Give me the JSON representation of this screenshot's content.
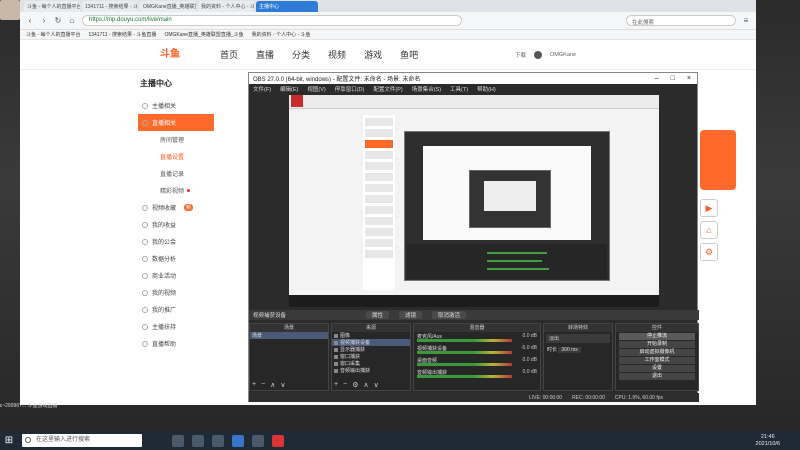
{
  "browser": {
    "tabs": [
      {
        "label": "斗鱼 - 每个人的直播平台"
      },
      {
        "label": "1341711 - 搜索结果 - 斗鱼直播"
      },
      {
        "label": "OMGKane直播_英雄联盟直播_斗鱼"
      },
      {
        "label": "我的资料 - 个人中心 - 斗鱼"
      },
      {
        "label": "主播中心"
      }
    ],
    "url": "https://mp.douyu.com/live/main",
    "search_placeholder": "在此搜索",
    "bookmarks": [
      "斗鱼 - 每个人的直播平台",
      "1341711 - 搜索结果 - 斗鱼直播",
      "OMGKane直播_英雄联盟直播_斗鱼",
      "我的资料 - 个人中心 - 斗鱼"
    ]
  },
  "site": {
    "logo_text": "斗鱼",
    "nav": [
      "首页",
      "直播",
      "分类",
      "视频",
      "游戏",
      "鱼吧"
    ],
    "download": "下载",
    "username": "OMGKane"
  },
  "sidebar": {
    "title": "主播中心",
    "items": [
      {
        "label": "主播相关"
      },
      {
        "label": "直播相关"
      },
      {
        "label": "房间管理"
      },
      {
        "label": "直播设置"
      },
      {
        "label": "直播记录"
      },
      {
        "label": "精彩视频"
      },
      {
        "label": "视频收藏"
      },
      {
        "label": "我的收益"
      },
      {
        "label": "我的公会"
      },
      {
        "label": "数据分析"
      },
      {
        "label": "商业活动"
      },
      {
        "label": "我的视频"
      },
      {
        "label": "我的推广"
      },
      {
        "label": "主播扶持"
      },
      {
        "label": "直播帮助"
      }
    ],
    "badge": "新"
  },
  "obs": {
    "title": "OBS 27.0.0 (64-bit, windows) - 配置文件: 未命名 - 场景: 未命名",
    "menu": [
      "文件(F)",
      "编辑(E)",
      "视图(V)",
      "停靠窗口(D)",
      "配置文件(P)",
      "场景集合(S)",
      "工具(T)",
      "帮助(H)"
    ],
    "source_bar": {
      "label": "视频捕获设备",
      "props": "属性",
      "filters": "滤镜",
      "deactivate": "取消激活"
    },
    "docks": {
      "scenes": {
        "title": "场景",
        "items": [
          "场景"
        ]
      },
      "sources": {
        "title": "来源",
        "items": [
          "图像",
          "视频捕获设备",
          "显示器捕获",
          "窗口捕获",
          "窗口采集",
          "音频输出捕获"
        ]
      },
      "mixer": {
        "title": "混音器",
        "rows": [
          {
            "name": "麦克风/Aux",
            "vol": "0.0 dB"
          },
          {
            "name": "视频捕获设备",
            "vol": "-5.0 dB"
          },
          {
            "name": "桌面音频",
            "vol": "0.0 dB"
          },
          {
            "name": "音频输出捕获",
            "vol": "0.0 dB"
          }
        ]
      },
      "transitions": {
        "title": "转场特效",
        "type": "淡出",
        "duration_label": "时长",
        "duration": "300 ms"
      },
      "controls": {
        "title": "控件",
        "buttons": [
          "停止推流",
          "开始录制",
          "启动虚拟摄像机",
          "工作室模式",
          "设置",
          "退出"
        ]
      }
    },
    "status": {
      "live": "LIVE: 00:00:00",
      "rec": "REC: 00:00:00",
      "cpu": "CPU: 1.9%, 60.00 fps"
    }
  },
  "left_text": "ε~2909б?... 斗鱼游戏直播",
  "taskbar": {
    "search_placeholder": "在这里输入进行搜索",
    "time": "21:46",
    "date": "2021/10/6"
  },
  "colors": {
    "accent": "#ff5d23",
    "obs_bg": "#2b2b2b",
    "taskbar": "#1f2a36"
  }
}
